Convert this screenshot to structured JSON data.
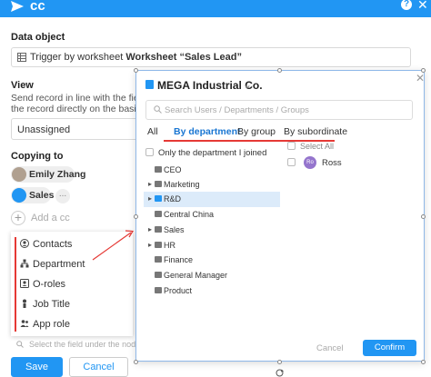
{
  "topbar": {
    "title": "cc",
    "help": "?",
    "close": "✕"
  },
  "data_object": {
    "label": "Data object",
    "prefix": "Trigger by worksheet",
    "worksheet": "Worksheet “Sales Lead”"
  },
  "view": {
    "label": "View",
    "line1": "Send record in line with the fields you c",
    "line2": "the record directly on the basis of his pe"
  },
  "assignee": {
    "value": "Unassigned"
  },
  "copying_to": {
    "label": "Copying to",
    "people": [
      {
        "name": "Emily Zhang"
      },
      {
        "name": "Sales"
      }
    ],
    "more": "...",
    "add_cc": "Add a cc"
  },
  "cc_menu": {
    "items": [
      {
        "label": "Contacts",
        "icon": "contacts-icon"
      },
      {
        "label": "Department",
        "icon": "department-icon"
      },
      {
        "label": "O-roles",
        "icon": "org-roles-icon"
      },
      {
        "label": "Job Title",
        "icon": "job-title-icon"
      },
      {
        "label": "App role",
        "icon": "app-role-icon"
      }
    ],
    "select_field_placeholder": "Select the field under the node ob"
  },
  "buttons": {
    "save": "Save",
    "cancel": "Cancel"
  },
  "picker": {
    "org_name": "MEGA Industrial Co.",
    "search_placeholder": "Search Users / Departments / Groups",
    "tabs": [
      "All",
      "By department",
      "By group",
      "By subordinate"
    ],
    "active_tab": "By department",
    "only_department": "Only the department I joined",
    "departments": [
      {
        "name": "CEO",
        "expandable": false,
        "selected": false
      },
      {
        "name": "Marketing",
        "expandable": true,
        "selected": false
      },
      {
        "name": "R&D",
        "expandable": true,
        "selected": true
      },
      {
        "name": "Central China",
        "expandable": false,
        "selected": false
      },
      {
        "name": "Sales",
        "expandable": true,
        "selected": false
      },
      {
        "name": "HR",
        "expandable": true,
        "selected": false
      },
      {
        "name": "Finance",
        "expandable": false,
        "selected": false
      },
      {
        "name": "General Manager",
        "expandable": false,
        "selected": false
      },
      {
        "name": "Product",
        "expandable": false,
        "selected": false
      }
    ],
    "select_all": "Select All",
    "members": [
      {
        "name": "Ross",
        "initials": "Ro"
      }
    ],
    "cancel": "Cancel",
    "confirm": "Confirm"
  },
  "colors": {
    "accent": "#2196f3",
    "annotation_red": "#e53935"
  }
}
